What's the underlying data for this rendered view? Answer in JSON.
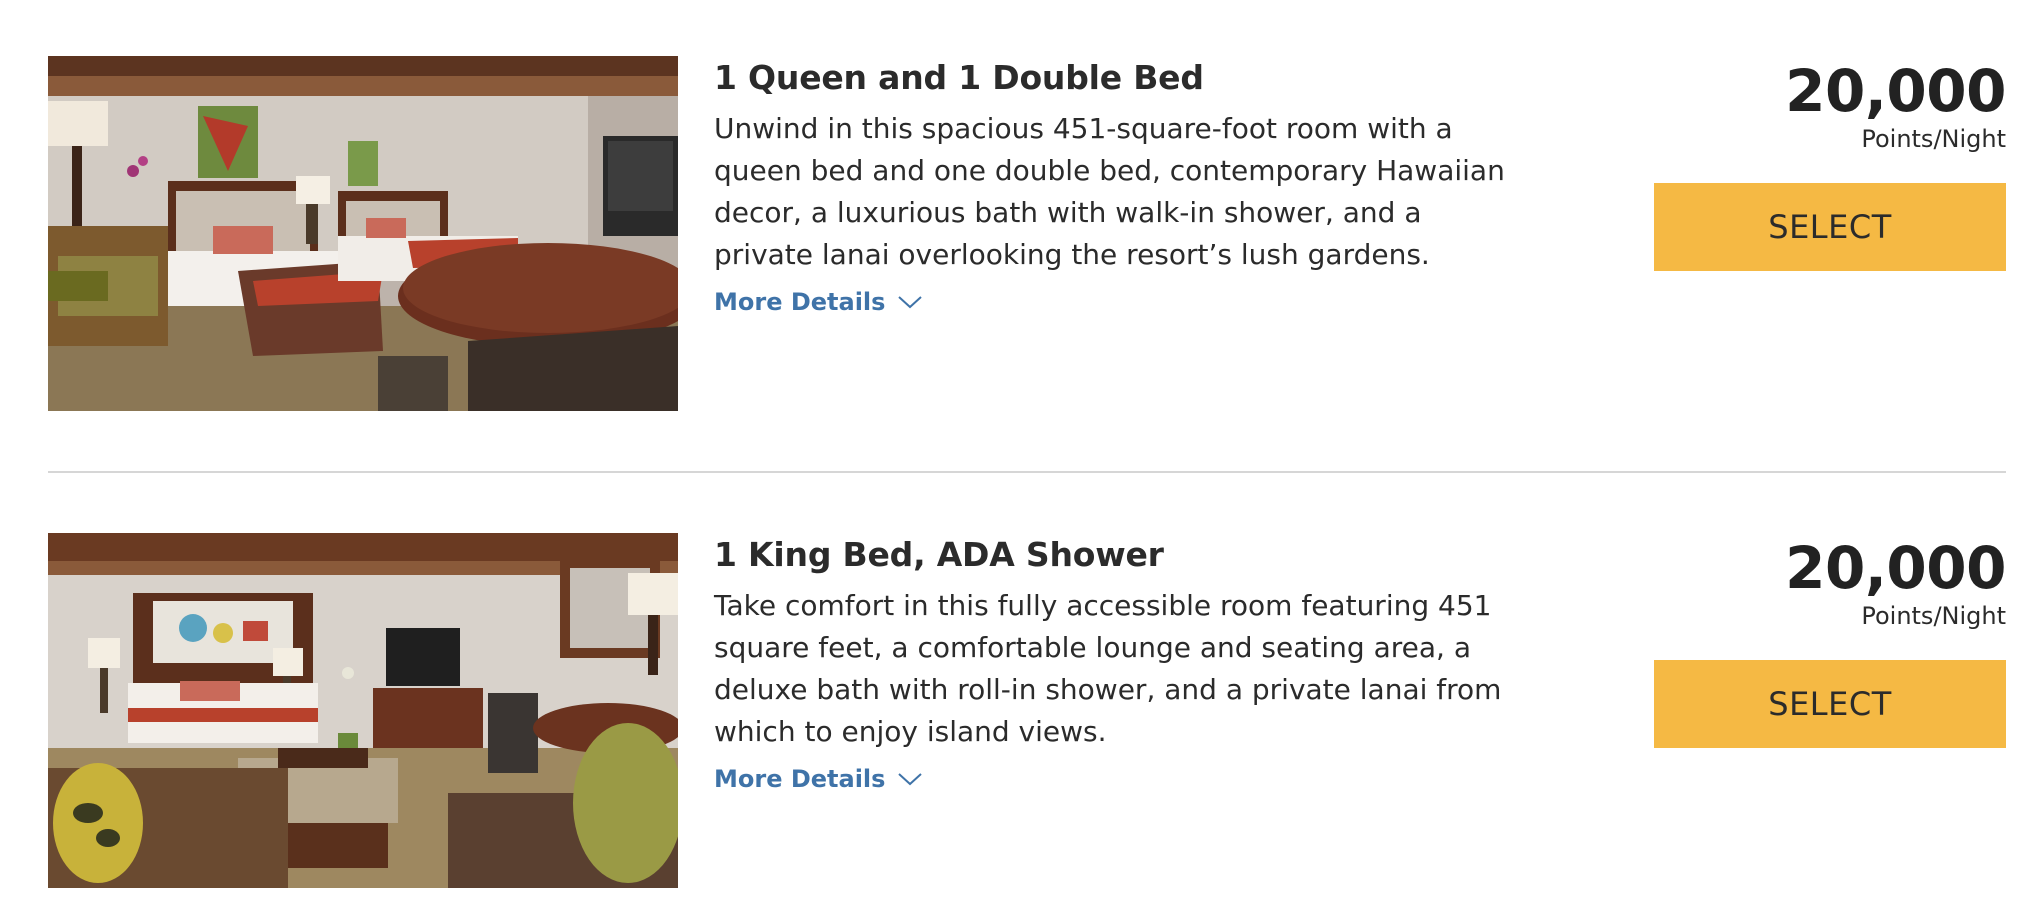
{
  "rooms": [
    {
      "name": "1 Queen and 1 Double Bed",
      "description": "Unwind in this spacious 451-square-foot room with a queen bed and one double bed, contemporary Hawaiian decor, a luxurious bath with walk-in shower, and a private lanai overlooking the resort’s lush gardens.",
      "more_details_label": "More Details",
      "points": "20,000",
      "points_unit": "Points/Night",
      "select_label": "SELECT"
    },
    {
      "name": "1 King Bed, ADA Shower",
      "description": "Take comfort in this fully accessible room featuring 451 square feet, a comfortable lounge and seating area, a deluxe bath with roll-in shower, and a private lanai from which to enjoy island views.",
      "more_details_label": "More Details",
      "points": "20,000",
      "points_unit": "Points/Night",
      "select_label": "SELECT"
    }
  ],
  "colors": {
    "select_button": "#f5b944",
    "link": "#3f73a8",
    "divider": "#d6d6d6"
  },
  "icons": {
    "more_details": "chevron-down-icon"
  }
}
